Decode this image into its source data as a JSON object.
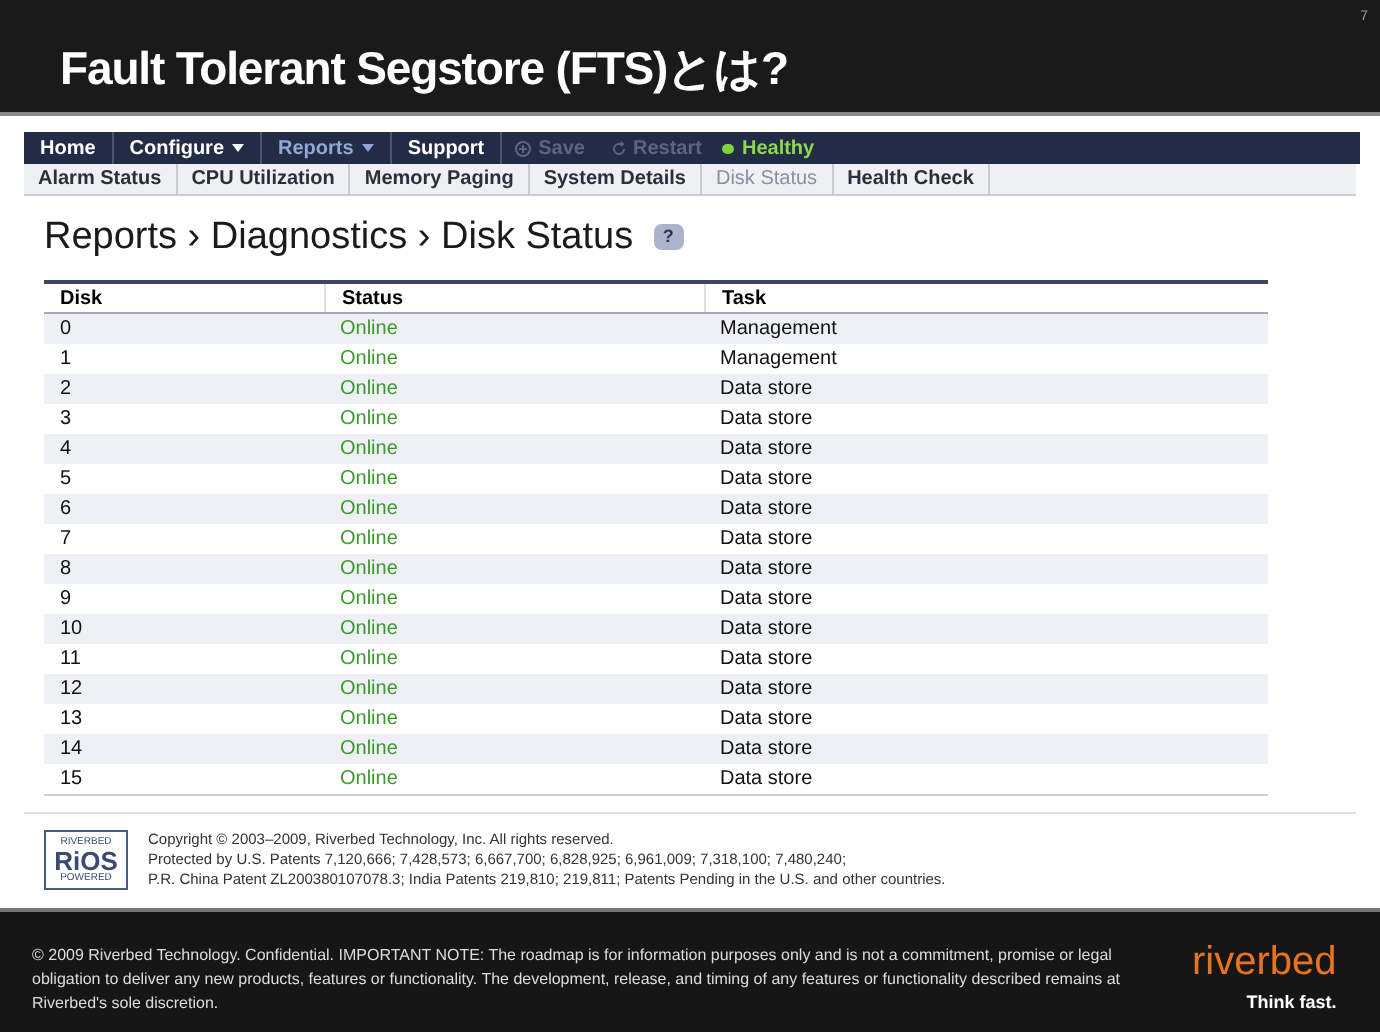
{
  "slide": {
    "title": "Fault Tolerant Segstore (FTS)とは?",
    "page_number": "7"
  },
  "nav": {
    "items": [
      {
        "label": "Home",
        "menu": false,
        "selected": false
      },
      {
        "label": "Configure",
        "menu": true,
        "selected": false
      },
      {
        "label": "Reports",
        "menu": true,
        "selected": true
      },
      {
        "label": "Support",
        "menu": false,
        "selected": false
      }
    ],
    "actions": [
      {
        "label": "Save",
        "kind": "save",
        "disabled": true
      },
      {
        "label": "Restart",
        "kind": "restart",
        "disabled": true
      }
    ],
    "health": "Healthy"
  },
  "subtabs": [
    {
      "label": "Alarm Status",
      "selected": false
    },
    {
      "label": "CPU Utilization",
      "selected": false
    },
    {
      "label": "Memory Paging",
      "selected": false
    },
    {
      "label": "System Details",
      "selected": false
    },
    {
      "label": "Disk Status",
      "selected": true
    },
    {
      "label": "Health Check",
      "selected": false
    }
  ],
  "breadcrumb": "Reports › Diagnostics › Disk Status",
  "help": "?",
  "table": {
    "columns": [
      "Disk",
      "Status",
      "Task"
    ],
    "rows": [
      [
        "0",
        "Online",
        "Management"
      ],
      [
        "1",
        "Online",
        "Management"
      ],
      [
        "2",
        "Online",
        "Data store"
      ],
      [
        "3",
        "Online",
        "Data store"
      ],
      [
        "4",
        "Online",
        "Data store"
      ],
      [
        "5",
        "Online",
        "Data store"
      ],
      [
        "6",
        "Online",
        "Data store"
      ],
      [
        "7",
        "Online",
        "Data store"
      ],
      [
        "8",
        "Online",
        "Data store"
      ],
      [
        "9",
        "Online",
        "Data store"
      ],
      [
        "10",
        "Online",
        "Data store"
      ],
      [
        "11",
        "Online",
        "Data store"
      ],
      [
        "12",
        "Online",
        "Data store"
      ],
      [
        "13",
        "Online",
        "Data store"
      ],
      [
        "14",
        "Online",
        "Data store"
      ],
      [
        "15",
        "Online",
        "Data store"
      ]
    ]
  },
  "copyright": {
    "logo": [
      "RIVERBED",
      "RiOS",
      "POWERED"
    ],
    "lines": [
      "Copyright © 2003–2009, Riverbed Technology, Inc. All rights reserved.",
      "Protected by U.S. Patents 7,120,666; 7,428,573; 6,667,700; 6,828,925; 6,961,009; 7,318,100; 7,480,240;",
      "P.R. China Patent ZL200380107078.3; India Patents 219,810; 219,811; Patents Pending in the U.S. and other countries."
    ]
  },
  "slide_footer": {
    "notice": "© 2009 Riverbed Technology. Confidential. IMPORTANT NOTE: The roadmap is for information purposes only and is not a commitment, promise or legal obligation to deliver any new products, features or functionality.  The development, release, and timing of any features or functionality described remains at Riverbed's sole discretion.",
    "brand": "riverbed",
    "tagline": "Think fast."
  }
}
